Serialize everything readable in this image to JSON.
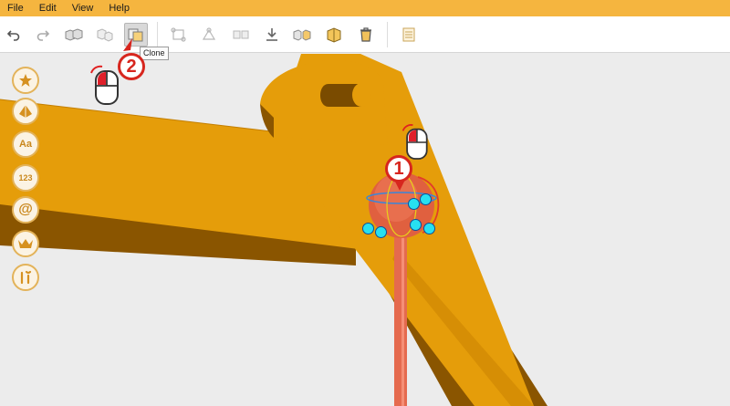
{
  "menu": {
    "file": "File",
    "edit": "Edit",
    "view": "View",
    "help": "Help"
  },
  "toolbar": {
    "tooltip": "Clone",
    "active_tool": "clone"
  },
  "sidebar": {
    "text_tool_label": "Aa",
    "number_tool_label": "123",
    "symbol_tool_label": "@"
  },
  "callouts": {
    "step1": "1",
    "step2": "2"
  },
  "colors": {
    "menubar": "#f5b53f",
    "model": "#e59d0a",
    "model_dark": "#8a5500",
    "rod": "#e56a4e",
    "handle": "#27e0f0",
    "badge": "#d7261e"
  }
}
